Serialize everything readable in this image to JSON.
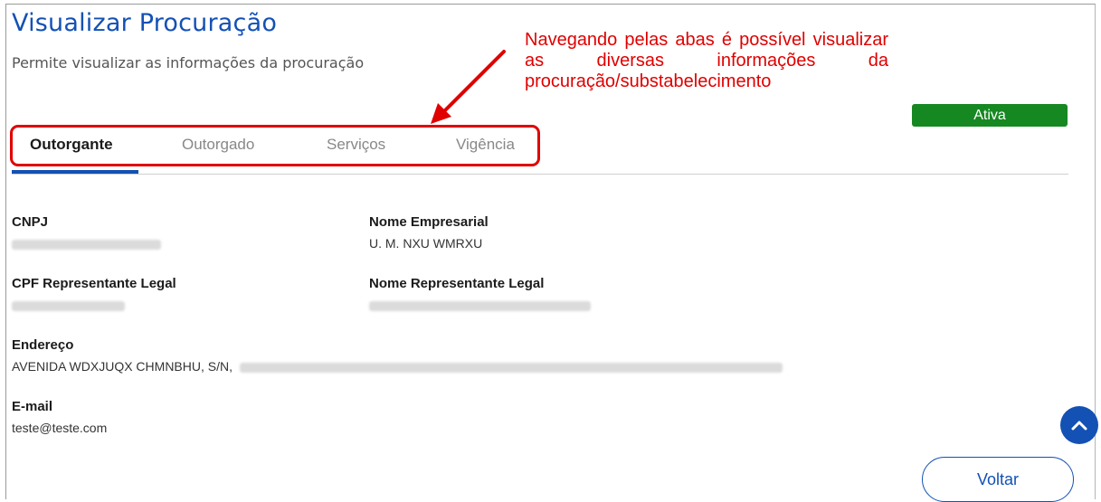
{
  "header": {
    "title": "Visualizar Procuração",
    "subtitle": "Permite visualizar as informações da procuração"
  },
  "annotation": {
    "text": "Navegando pelas abas é possível visualizar as diversas informações da procuração/substabelecimento",
    "color": "#e00000"
  },
  "status": {
    "label": "Ativa",
    "color": "#168821"
  },
  "tabs": [
    {
      "label": "Outorgante",
      "active": true
    },
    {
      "label": "Outorgado",
      "active": false
    },
    {
      "label": "Serviços",
      "active": false
    },
    {
      "label": "Vigência",
      "active": false
    }
  ],
  "fields": {
    "cnpj": {
      "label": "CNPJ"
    },
    "nome_empresarial": {
      "label": "Nome Empresarial",
      "value": "U. M. NXU WMRXU"
    },
    "cpf_representante": {
      "label": "CPF Representante Legal"
    },
    "nome_representante": {
      "label": "Nome Representante Legal"
    },
    "endereco": {
      "label": "Endereço",
      "value": "AVENIDA WDXJUQX CHMNBHU, S/N,"
    },
    "email": {
      "label": "E-mail",
      "value": "teste@teste.com"
    }
  },
  "actions": {
    "voltar_label": "Voltar"
  },
  "icons": {
    "scroll_top": "chevron-up-icon"
  },
  "colors": {
    "accent": "#1351b4"
  }
}
